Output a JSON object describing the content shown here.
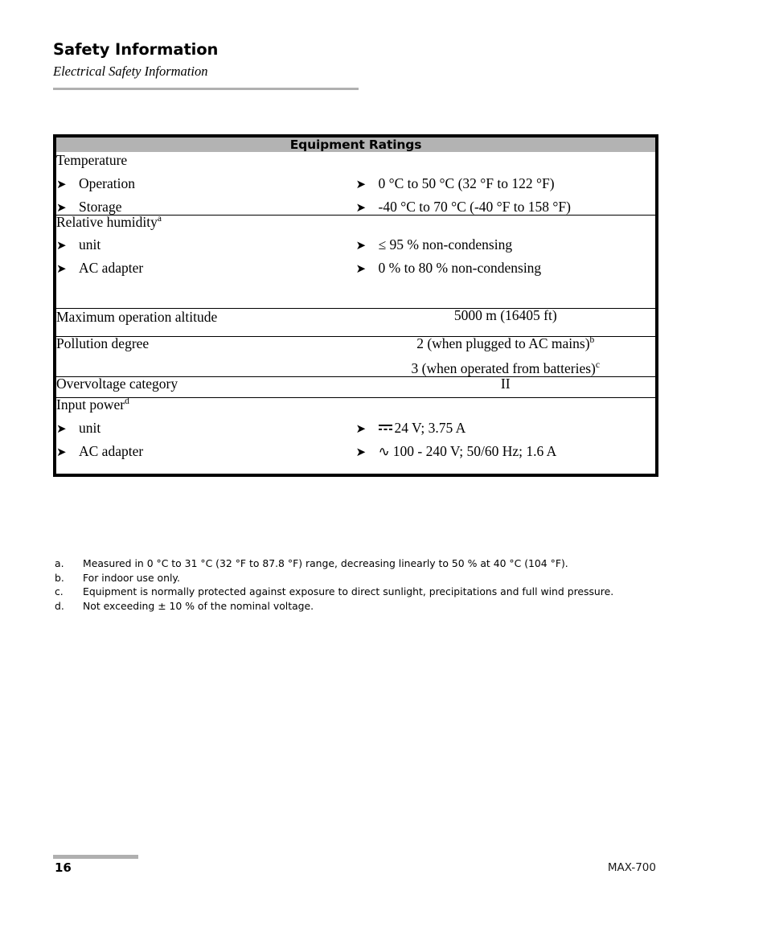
{
  "header": {
    "title": "Safety Information",
    "subtitle": "Electrical Safety Information"
  },
  "table": {
    "caption": "Equipment Ratings",
    "rows": [
      {
        "label": "Temperature",
        "label_sup": "",
        "label_bullets": [
          "Operation",
          "Storage"
        ],
        "value_bullets": [
          "0 °C to 50 °C (32 °F to 122 °F)",
          "-40 °C to 70 °C (-40 °F to 158 °F)"
        ],
        "centered_values": []
      },
      {
        "label": "Relative humidity",
        "label_sup": "a",
        "label_bullets": [
          "unit",
          "AC adapter"
        ],
        "value_bullets": [
          "≤ 95 % non-condensing",
          "0 % to 80 % non-condensing"
        ],
        "centered_values": []
      },
      {
        "label": "Maximum operation altitude",
        "label_sup": "",
        "label_bullets": [],
        "value_bullets": [],
        "centered_values": [
          "5000 m (16405 ft)"
        ]
      },
      {
        "label": "Pollution degree",
        "label_sup": "",
        "label_bullets": [],
        "value_bullets": [],
        "centered_values": [
          "2 (when plugged to AC mains)",
          "3 (when operated from batteries)"
        ],
        "centered_sups": [
          "b",
          "c"
        ]
      },
      {
        "label": "Overvoltage category",
        "label_sup": "",
        "label_bullets": [],
        "value_bullets": [],
        "centered_values": [
          "II"
        ]
      },
      {
        "label": "Input power",
        "label_sup": "d",
        "label_bullets": [
          "unit",
          "AC adapter"
        ],
        "value_bullets": [
          "24 V; 3.75 A",
          "100 - 240 V; 50/60 Hz; 1.6 A"
        ],
        "value_symbols": [
          "dc-symbol",
          "ac-symbol"
        ],
        "centered_values": []
      }
    ]
  },
  "footnotes": [
    {
      "key": "a.",
      "text": "Measured in 0 °C to 31 °C (32 °F to 87.8 °F) range, decreasing linearly to 50 % at 40 °C (104 °F)."
    },
    {
      "key": "b.",
      "text": "For indoor use only."
    },
    {
      "key": "c.",
      "text": "Equipment is normally protected against exposure to direct sunlight, precipitations and full wind pressure."
    },
    {
      "key": "d.",
      "text": "Not exceeding ± 10 % of the nominal voltage."
    }
  ],
  "footer": {
    "page_number": "16",
    "model": "MAX-700"
  },
  "icons": {
    "bullet_arrow": "➤",
    "ac_tilde": "∿"
  },
  "colors": {
    "header_fill": "#b3b3b3",
    "rule_gray": "#b0b0b0",
    "border_black": "#000000"
  }
}
